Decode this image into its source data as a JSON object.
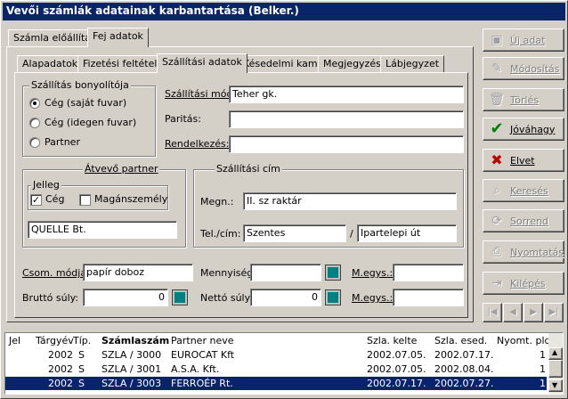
{
  "window": {
    "title": "Vevői számlák adatainak karbantartása (Belker.)"
  },
  "outer_tabs": [
    {
      "label": "Számla előállítás"
    },
    {
      "label": "Fej adatok"
    }
  ],
  "inner_tabs": [
    {
      "label": "Alapadatok"
    },
    {
      "label": "Fizetési feltételek"
    },
    {
      "label": "Szállítási adatok"
    },
    {
      "label": "Késedelmi kamat"
    },
    {
      "label": "Megjegyzés"
    },
    {
      "label": "Lábjegyzet"
    }
  ],
  "shipping_group": {
    "title": "Szállítás bonyolítója",
    "options": [
      {
        "label": "Cég (saját fuvar)",
        "selected": true
      },
      {
        "label": "Cég (idegen fuvar)",
        "selected": false
      },
      {
        "label": "Partner",
        "selected": false
      }
    ]
  },
  "shipping_mode": {
    "label": "Szállítási mód:",
    "value": "Teher gk."
  },
  "parity": {
    "label": "Paritás:",
    "value": ""
  },
  "destination": {
    "label": "Rendelkezés:",
    "value": ""
  },
  "receiver": {
    "title": "Átvevő partner",
    "jelleg_title": "Jelleg",
    "ceg_label": "Cég",
    "ceg_checked": true,
    "private_label": "Magánszemély",
    "private_checked": false,
    "name": "QUELLE Bt."
  },
  "address": {
    "title": "Szállítási cím",
    "name_label": "Megn.:",
    "name_value": "II. sz raktár",
    "city_label": "Tel./cím:",
    "city_value": "Szentes",
    "separator": "/",
    "street_value": "Ipartelepi út"
  },
  "packaging": {
    "label": "Csom. módja:",
    "value": "papír doboz"
  },
  "quantity": {
    "label": "Mennyiség:",
    "value": ""
  },
  "unit1": {
    "label": "M.egys.:",
    "value": ""
  },
  "gross_weight": {
    "label": "Bruttó súly:",
    "value": "0"
  },
  "net_weight": {
    "label": "Nettó súly:",
    "value": "0"
  },
  "unit2": {
    "label": "M.egys.:",
    "value": ""
  },
  "side_buttons": [
    {
      "label": "Új adat",
      "icon": "new-icon",
      "enabled": false
    },
    {
      "label": "Módosítás",
      "icon": "edit-icon",
      "enabled": false
    },
    {
      "label": "Törlés",
      "icon": "trash-icon",
      "enabled": false
    },
    {
      "label": "Jóváhagy",
      "icon": "checkmark-icon",
      "enabled": true
    },
    {
      "label": "Elvet",
      "icon": "cross-icon",
      "enabled": true
    },
    {
      "label": "Keresés",
      "icon": "search-icon",
      "enabled": false
    },
    {
      "label": "Sorrend",
      "icon": "sort-icon",
      "enabled": false
    },
    {
      "label": "Nyomtatás",
      "icon": "printer-icon",
      "enabled": false
    },
    {
      "label": "Kilépés",
      "icon": "exit-icon",
      "enabled": false
    }
  ],
  "grid": {
    "headers": [
      "Jel",
      "Tárgyév",
      "Típ.",
      "Számlaszám",
      "Partner neve",
      "Szla. kelte",
      "Szla. esed.",
      "Nyomt. pld."
    ],
    "rows": [
      {
        "jel": "",
        "year": "2002",
        "type": "S",
        "number": "SZLA / 3000",
        "partner": "EUROCAT Kft",
        "date": "2002.07.05.",
        "due": "2002.07.17.",
        "copies": "1"
      },
      {
        "jel": "",
        "year": "2002",
        "type": "S",
        "number": "SZLA / 3001",
        "partner": "A.S.A. Kft.",
        "date": "2002.07.05.",
        "due": "2002.08.04.",
        "copies": "1"
      },
      {
        "jel": "",
        "year": "2002",
        "type": "S",
        "number": "SZLA / 3003",
        "partner": "FERROÉP Rt.",
        "date": "2002.07.17.",
        "due": "2002.07.27.",
        "copies": "1"
      }
    ]
  }
}
